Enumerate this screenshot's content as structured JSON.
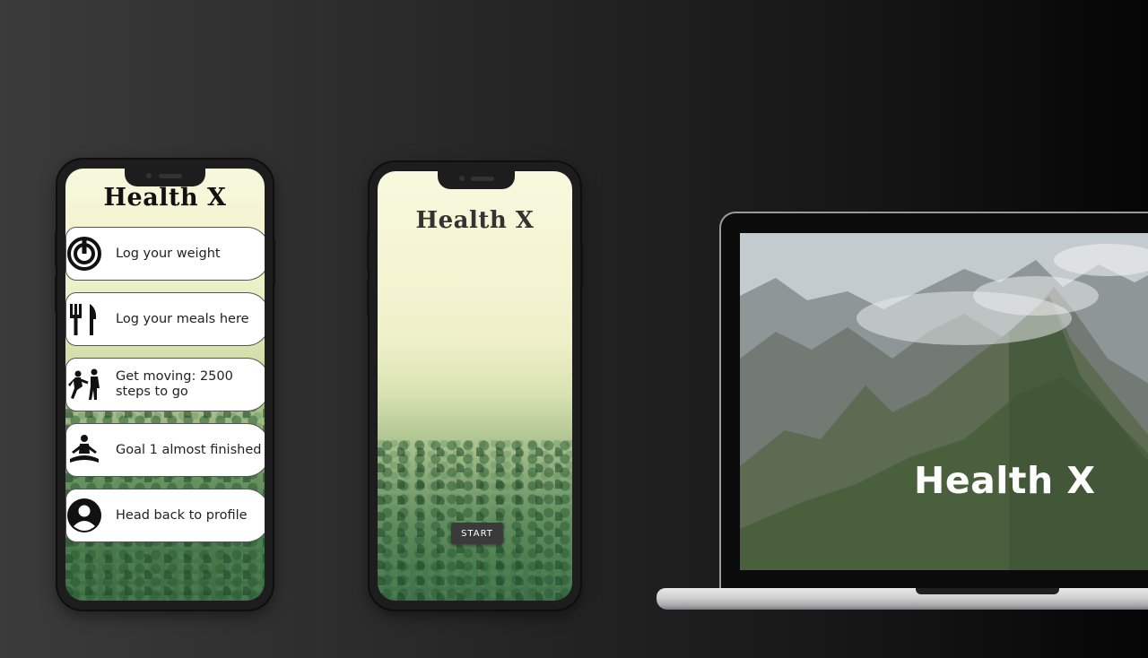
{
  "app": {
    "name": "Health X"
  },
  "phone_menu": {
    "title": "Health X",
    "items": [
      {
        "label": "Log your weight",
        "icon": "scale-icon"
      },
      {
        "label": "Log your meals here",
        "icon": "fork-knife-icon"
      },
      {
        "label": "Get moving: 2500 steps to go",
        "icon": "exercise-people-icon"
      },
      {
        "label": "Goal 1 almost finished",
        "icon": "meditation-icon"
      },
      {
        "label": "Head back to profile",
        "icon": "profile-icon"
      }
    ]
  },
  "phone_splash": {
    "title": "Health X",
    "start_label": "START"
  },
  "laptop": {
    "title": "Health X"
  },
  "colors": {
    "card_bg": "#ffffff",
    "start_button_bg": "#3a3a3a",
    "title_dark": "#1e1e1e"
  }
}
